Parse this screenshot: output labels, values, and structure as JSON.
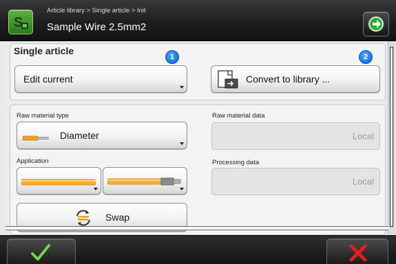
{
  "header": {
    "breadcrumb": "Article library > Single article > Init",
    "title": "Sample Wire 2.5mm2",
    "app_icon": "s-logo-icon",
    "next_icon": "arrow-right-circle-icon"
  },
  "single_article": {
    "title": "Single article",
    "edit_button": {
      "label": "Edit current",
      "badge": "1"
    },
    "convert_button": {
      "label": "Convert to library ...",
      "badge": "2",
      "icon": "convert-to-library-icon"
    }
  },
  "raw_material": {
    "type_label": "Raw material type",
    "type_value": "Diameter",
    "type_icon": "wire-diameter-icon",
    "data_label": "Raw material data",
    "data_value": "Local"
  },
  "application": {
    "label": "Application",
    "left_icon": "wire-plain-icon",
    "right_icon": "wire-crimp-icon",
    "processing_label": "Processing data",
    "processing_value": "Local"
  },
  "swap_button": {
    "label": "Swap",
    "icon": "swap-arrows-icon"
  },
  "footer": {
    "ok_icon": "checkmark-icon",
    "cancel_icon": "close-x-icon"
  },
  "colors": {
    "accent_green": "#3f9e2b",
    "badge_blue": "#0a63c8",
    "cancel_red": "#e02020",
    "wire_orange": "#f0a020"
  }
}
